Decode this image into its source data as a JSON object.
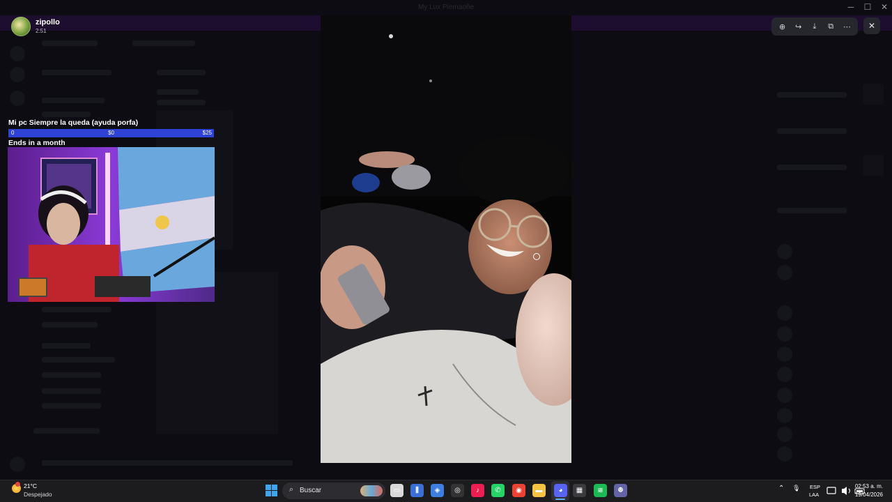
{
  "window": {
    "title": "My Lux Piemaoñe",
    "controls": {
      "minimize": "─",
      "maximize": "☐",
      "close": "✕"
    }
  },
  "viewer": {
    "user_name": "zipollo",
    "timestamp": "2:51",
    "toolbar": {
      "zoom": "⊕",
      "forward": "↪",
      "download": "⤓",
      "open_external": "⧉",
      "more": "⋯"
    },
    "close": "✕"
  },
  "stream_overlay": {
    "goal_title": "Mi pc Siempre la queda (ayuda porfa)",
    "goal_start": "0",
    "goal_current": "$0",
    "goal_target": "$25",
    "goal_progress_fraction": 0,
    "ends_text": "Ends in a month"
  },
  "taskbar": {
    "weather_temp": "21°C",
    "weather_desc": "Despejado",
    "search_icon": "⌕",
    "search_placeholder": "Buscar",
    "apps": [
      {
        "name": "file-explorer-icon",
        "glyph": "▭",
        "color": "#d9d9d9"
      },
      {
        "name": "audio-app-icon",
        "glyph": "⫼",
        "color": "#3a6fd8"
      },
      {
        "name": "cube-app-icon",
        "glyph": "◈",
        "color": "#3d7ee0"
      },
      {
        "name": "github-icon",
        "glyph": "◎",
        "color": "#333333"
      },
      {
        "name": "tiktok-icon",
        "glyph": "♪",
        "color": "#ee1d52"
      },
      {
        "name": "whatsapp-icon",
        "glyph": "✆",
        "color": "#25d366"
      },
      {
        "name": "chrome-icon",
        "glyph": "◉",
        "color": "#ea4335"
      },
      {
        "name": "folder-icon",
        "glyph": "▬",
        "color": "#f5c242"
      },
      {
        "name": "discord-icon",
        "glyph": "◕",
        "color": "#5865f2"
      },
      {
        "name": "store-icon",
        "glyph": "▦",
        "color": "#3a3a3f"
      },
      {
        "name": "spotify-icon",
        "glyph": "≋",
        "color": "#1db954"
      },
      {
        "name": "teams-icon",
        "glyph": "ꔮ",
        "color": "#6264a7"
      }
    ],
    "tray_chevron": "⌃",
    "tray_mic": "🎙",
    "lang_line1": "ESP",
    "lang_line2": "LAA",
    "clock_time": "02:53 a. m.",
    "clock_date": "19/04/2026"
  }
}
